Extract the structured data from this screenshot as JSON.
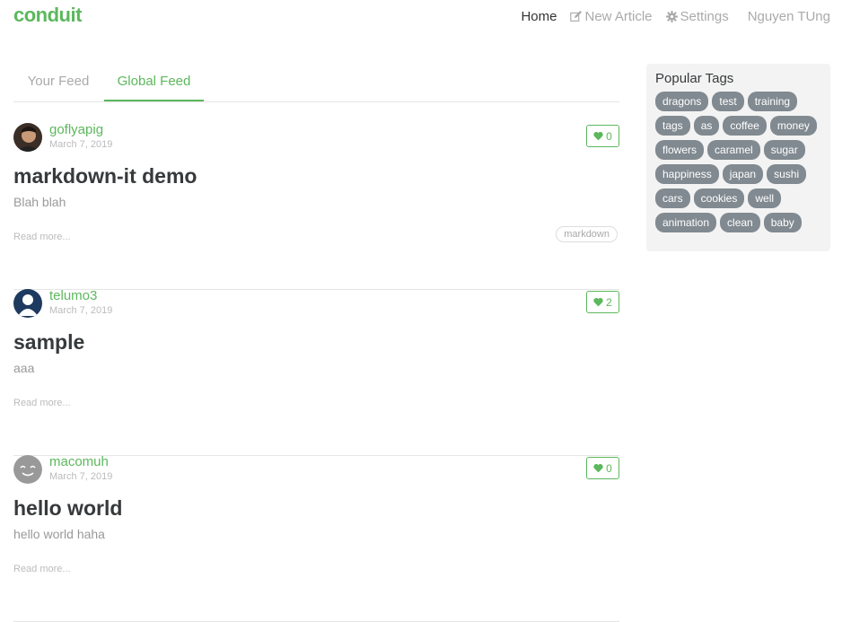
{
  "nav": {
    "brand": "conduit",
    "home": "Home",
    "new_article": "New Article",
    "settings": "Settings",
    "user": "Nguyen TUng"
  },
  "feed_tabs": {
    "your_feed": "Your Feed",
    "global_feed": "Global Feed"
  },
  "articles": [
    {
      "author": "goflyapig",
      "date": "March 7, 2019",
      "favorites": "0",
      "title": "markdown-it demo",
      "description": "Blah blah",
      "read_more": "Read more...",
      "tags": [
        "markdown"
      ]
    },
    {
      "author": "telumo3",
      "date": "March 7, 2019",
      "favorites": "2",
      "title": "sample",
      "description": "aaa",
      "read_more": "Read more...",
      "tags": []
    },
    {
      "author": "macomuh",
      "date": "March 7, 2019",
      "favorites": "0",
      "title": "hello world",
      "description": "hello world haha",
      "read_more": "Read more...",
      "tags": []
    }
  ],
  "sidebar": {
    "heading": "Popular Tags",
    "tags": [
      "dragons",
      "test",
      "training",
      "tags",
      "as",
      "coffee",
      "money",
      "flowers",
      "caramel",
      "sugar",
      "happiness",
      "japan",
      "sushi",
      "cars",
      "cookies",
      "well",
      "animation",
      "clean",
      "baby"
    ]
  },
  "colors": {
    "brand": "#5cb85c",
    "tag_bg": "#818a91",
    "sidebar_bg": "#f3f3f3"
  }
}
